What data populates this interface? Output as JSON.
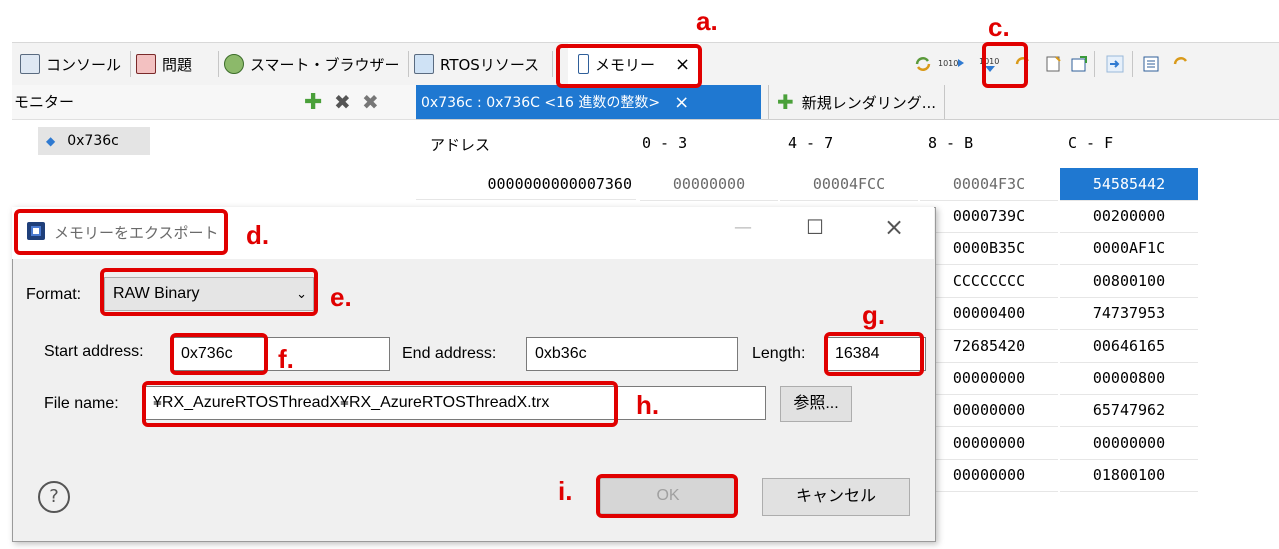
{
  "annotations": {
    "a": "a.",
    "c": "c.",
    "d": "d.",
    "e": "e.",
    "f": "f.",
    "g": "g.",
    "h": "h.",
    "i": "i."
  },
  "view_tabs": [
    {
      "label": "コンソール",
      "icon": "console-icon"
    },
    {
      "label": "問題",
      "icon": "problems-icon"
    },
    {
      "label": "スマート・ブラウザー",
      "icon": "smart-browser-icon"
    },
    {
      "label": "RTOSリソース",
      "icon": "rtos-resource-icon"
    },
    {
      "label": "メモリー",
      "icon": "memory-icon",
      "close": "×"
    }
  ],
  "monitor": {
    "title": "モニター",
    "items": [
      {
        "label": "0x736c"
      }
    ]
  },
  "rendering": {
    "active_tab": "0x736c : 0x736C <16 進数の整数>",
    "active_close": "×",
    "new_tab": "新規レンダリング..."
  },
  "memory": {
    "headers": [
      "アドレス",
      "0 - 3",
      "4 - 7",
      "8 - B",
      "C - F"
    ],
    "first_row": [
      "0000000000007360",
      "00000000",
      "00004FCC",
      "00004F3C",
      "54585442"
    ],
    "visible_tail_rows": [
      [
        "0000739C",
        "00200000"
      ],
      [
        "0000B35C",
        "0000AF1C"
      ],
      [
        "CCCCCCCC",
        "00800100"
      ],
      [
        "00000400",
        "74737953"
      ],
      [
        "72685420",
        "00646165"
      ],
      [
        "00000000",
        "00000800"
      ],
      [
        "00000000",
        "65747962"
      ],
      [
        "00000000",
        "00000000"
      ],
      [
        "00000000",
        "01800100"
      ]
    ]
  },
  "dialog": {
    "title": "メモリーをエクスポート",
    "minimize": "—",
    "maximize": "☐",
    "close": "×",
    "format_label": "Format:",
    "format_value": "RAW Binary",
    "start_label": "Start address:",
    "start_value": "0x736c",
    "end_label": "End address:",
    "end_value": "0xb36c",
    "length_label": "Length:",
    "length_value": "16384",
    "file_label": "File name:",
    "file_value": "¥RX_AzureRTOSThreadX¥RX_AzureRTOSThreadX.trx",
    "browse": "参照...",
    "help": "?",
    "ok": "OK",
    "cancel": "キャンセル"
  },
  "colors": {
    "accent": "#1f78d1",
    "annotation": "#e00000"
  }
}
